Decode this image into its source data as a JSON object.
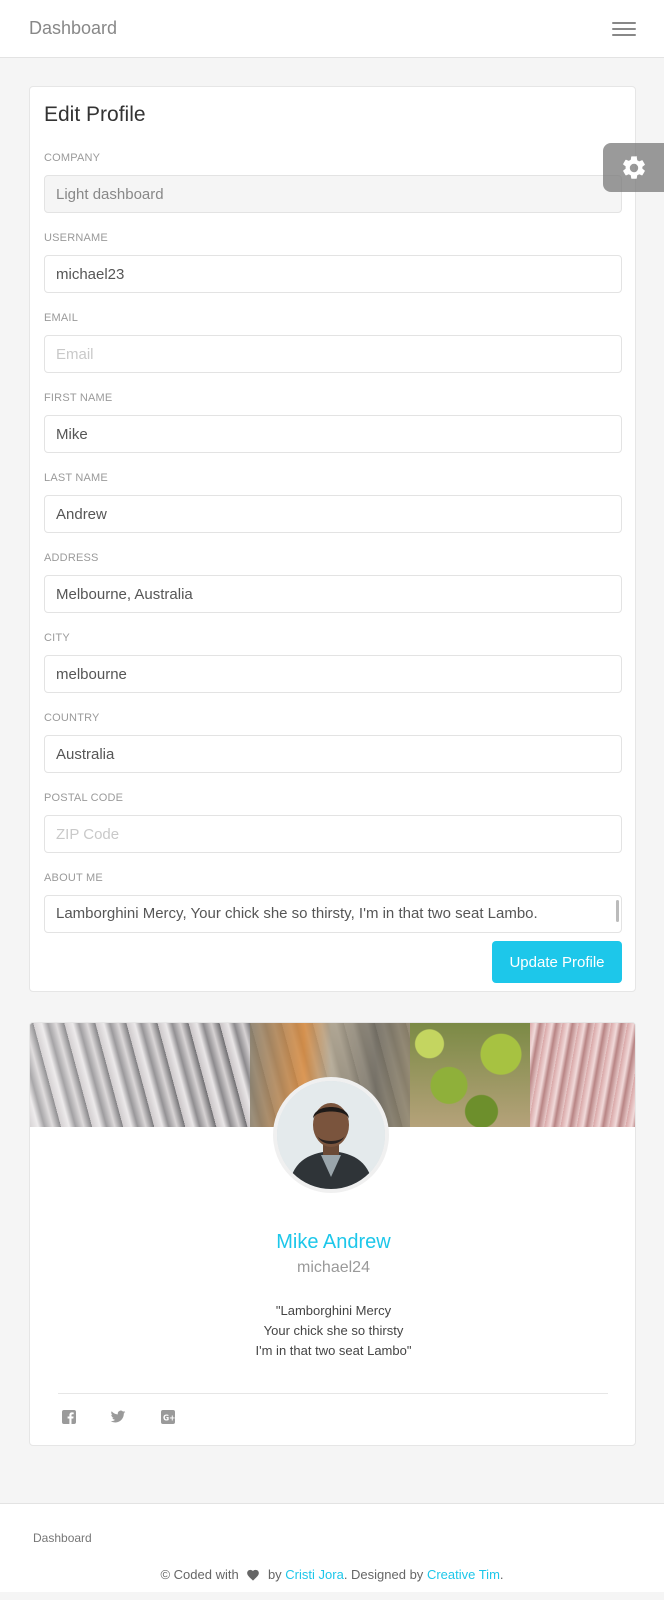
{
  "navbar": {
    "brand": "Dashboard",
    "menu_icon": "hamburger-menu-icon"
  },
  "settings": {
    "icon": "gear-icon"
  },
  "edit_profile": {
    "title": "Edit Profile",
    "fields": {
      "company": {
        "label": "Company",
        "value": "Light dashboard",
        "placeholder": "",
        "disabled": true
      },
      "username": {
        "label": "Username",
        "value": "michael23",
        "placeholder": ""
      },
      "email": {
        "label": "Email",
        "value": "",
        "placeholder": "Email"
      },
      "first_name": {
        "label": "First Name",
        "value": "Mike",
        "placeholder": ""
      },
      "last_name": {
        "label": "Last Name",
        "value": "Andrew",
        "placeholder": ""
      },
      "address": {
        "label": "Address",
        "value": "Melbourne, Australia",
        "placeholder": ""
      },
      "city": {
        "label": "City",
        "value": "melbourne",
        "placeholder": ""
      },
      "country": {
        "label": "Country",
        "value": "Australia",
        "placeholder": ""
      },
      "postal_code": {
        "label": "Postal Code",
        "value": "",
        "placeholder": "ZIP Code"
      },
      "about_me": {
        "label": "About Me",
        "value": "Lamborghini Mercy, Your chick she so thirsty, I'm in that two seat Lambo."
      }
    },
    "submit_label": "Update Profile",
    "accent_color": "#1dc7ea"
  },
  "user_card": {
    "name": "Mike Andrew",
    "username": "michael24",
    "bio_lines": [
      "\"Lamborghini Mercy",
      "Your chick she so thirsty",
      "I'm in that two seat Lambo\""
    ],
    "social_icons": [
      "facebook-icon",
      "twitter-icon",
      "google-plus-icon"
    ]
  },
  "footer": {
    "link": "Dashboard",
    "copyright_prefix": "© Coded with",
    "by": "by",
    "author": "Cristi Jora",
    "designed_by": ". Designed by",
    "designer": "Creative Tim",
    "suffix": "."
  }
}
